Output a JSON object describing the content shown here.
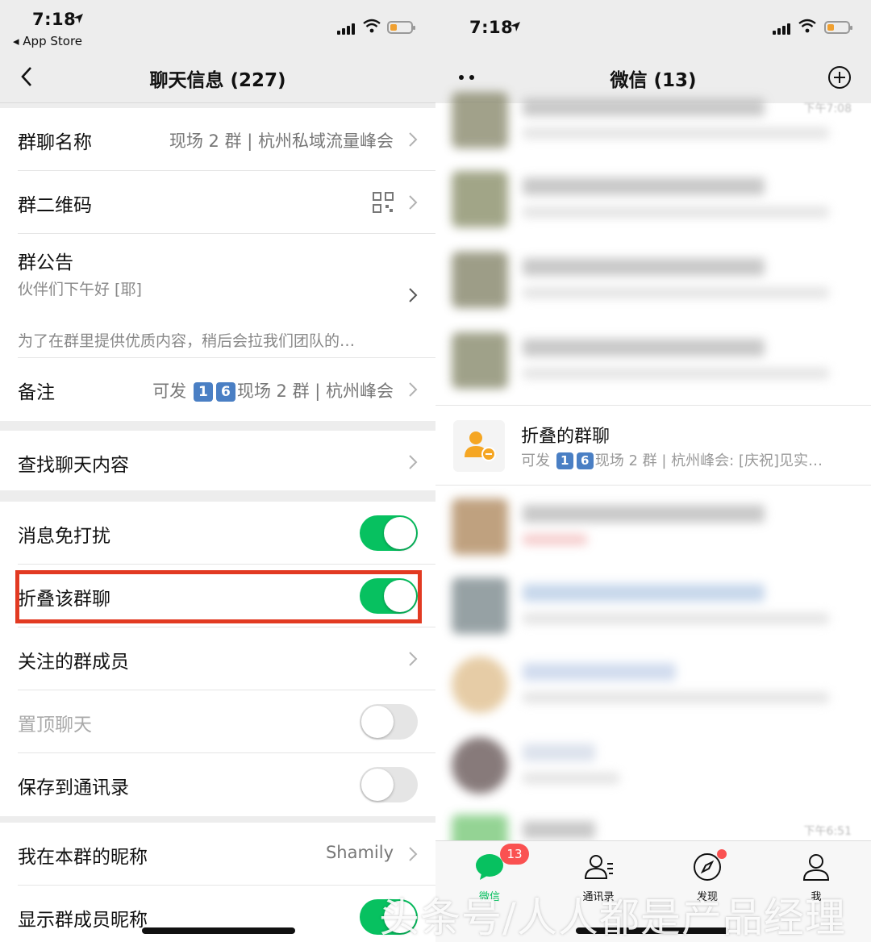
{
  "left": {
    "status": {
      "time": "7:18",
      "back_app": "◂ App Store"
    },
    "nav": {
      "title": "聊天信息 (227)"
    },
    "rows": {
      "group_name": {
        "label": "群聊名称",
        "value": "现场 2 群 | 杭州私域流量峰会"
      },
      "qr_code": {
        "label": "群二维码"
      },
      "announcement": {
        "label": "群公告",
        "line1": "伙伴们下午好 [耶]",
        "line2": "为了在群里提供优质内容，稍后会拉我们团队的…"
      },
      "remark": {
        "label": "备注",
        "prefix": "可发",
        "num1": "1",
        "num2": "6",
        "suffix": "现场 2 群 | 杭州峰会"
      },
      "search": {
        "label": "查找聊天内容"
      },
      "mute": {
        "label": "消息免打扰",
        "on": true
      },
      "fold": {
        "label": "折叠该群聊",
        "on": true
      },
      "followed": {
        "label": "关注的群成员"
      },
      "pin": {
        "label": "置顶聊天",
        "on": false
      },
      "save": {
        "label": "保存到通讯录",
        "on": false
      },
      "nickname": {
        "label": "我在本群的昵称",
        "value": "Shamily"
      },
      "show_nick": {
        "label": "显示群成员昵称",
        "on": true
      }
    }
  },
  "right": {
    "status": {
      "time": "7:18"
    },
    "nav": {
      "title": "微信 (13)"
    },
    "folded": {
      "name": "折叠的群聊",
      "preview_prefix": "可发",
      "num1": "1",
      "num2": "6",
      "preview_suffix": "现场 2 群 | 杭州峰会: [庆祝]见实…"
    },
    "timestamps": {
      "top": "下午7:08",
      "bottom": "下午6:51"
    },
    "tabs": [
      {
        "label": "微信",
        "icon": "chat-bubble-icon",
        "active": true
      },
      {
        "label": "通讯录",
        "icon": "contacts-icon",
        "active": false
      },
      {
        "label": "发现",
        "icon": "compass-icon",
        "active": false
      },
      {
        "label": "我",
        "icon": "person-icon",
        "active": false
      }
    ],
    "tab_badge": "13"
  },
  "watermark": "头条号/人人都是产品经理",
  "colors": {
    "accent_green": "#07c160",
    "highlight_red": "#e23a22",
    "badge_red": "#fa5151",
    "number_badge_blue": "#4a7fc4"
  }
}
